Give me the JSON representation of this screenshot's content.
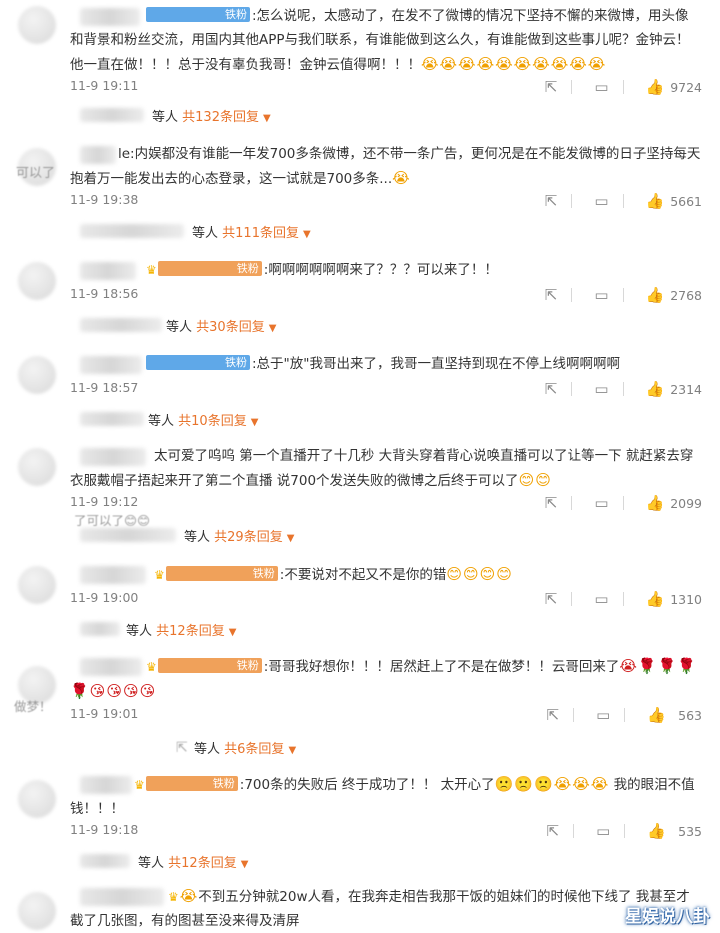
{
  "comments": [
    {
      "badge": "铁粉",
      "text": ":怎么说呢，太感动了，在发不了微博的情况下坚持不懈的来微博，用头像和背景和粉丝交流，用国内其他APP与我们联系，有谁能做到这么久，有谁能做到这些事儿呢？金钟云！他一直在做！！！总于没有辜负我哥！金钟云值得啊！！！",
      "emoji": "😭😭😭😭😭😭😭😭😭😭",
      "time": "11-9 19:11",
      "likes": "9724",
      "replies_prefix": "等人",
      "replies_count": "共132条回复"
    },
    {
      "badge": "",
      "text": "le:内娱都没有谁能一年发700多条微博，还不带一条广告，更何况是在不能发微博的日子坚持每天抱着万一能发出去的心态登录，这一试就是700多条...",
      "emoji": "😭",
      "time": "11-9 19:38",
      "likes": "5661",
      "replies_prefix": "等人",
      "replies_count": "共111条回复"
    },
    {
      "badge": "铁粉",
      "text": ":啊啊啊啊啊啊来了？？？可以来了！！",
      "emoji": "",
      "time": "11-9 18:56",
      "likes": "2768",
      "replies_prefix": "等人",
      "replies_count": "共30条回复"
    },
    {
      "badge": "铁粉",
      "text": ":总于\"放\"我哥出来了，我哥一直坚持到现在不停上线啊啊啊啊",
      "emoji": "",
      "time": "11-9 18:57",
      "likes": "2314",
      "replies_prefix": "等人",
      "replies_count": "共10条回复"
    },
    {
      "badge": "",
      "text": "太可爱了呜呜 第一个直播开了十几秒 大背头穿着背心说唤直播可以了让等一下 就赶紧去穿衣服戴帽子捂起来开了第二个直播 说700个发送失败的微博之后终于可以了",
      "emoji": "😊😊",
      "time": "11-9 19:12",
      "likes": "2099",
      "replies_prefix": "等人",
      "replies_count": "共29条回复"
    },
    {
      "badge": "铁粉",
      "text": ":不要说对不起又不是你的错",
      "emoji": "😊😊😊😊",
      "time": "11-9 19:00",
      "likes": "1310",
      "replies_prefix": "等人",
      "replies_count": "共12条回复"
    },
    {
      "badge": "铁粉",
      "text": ":哥哥我好想你！！！居然赶上了不是在做梦！！云哥回来了",
      "emoji": "😭🌹🌹🌹🌹😘😘😘😘",
      "time": "11-9 19:01",
      "likes": "563",
      "replies_prefix": "等人",
      "replies_count": "共6条回复"
    },
    {
      "badge": "铁粉",
      "text": ":700条的失败后 终于成功了！！ 太开心了",
      "emoji": "🙁🙁🙁😭😭😭",
      "text2": "我的眼泪不值钱！！！",
      "time": "11-9 19:18",
      "likes": "535",
      "replies_prefix": "等人",
      "replies_count": "共12条回复"
    },
    {
      "badge": "",
      "text": "不到五分钟就20w人看，在我奔走相告我那干饭的姐妹们的时候他下线了 我甚至才截了几张图，有的图甚至没来得及清屏",
      "emoji": "😭",
      "time": "",
      "likes": "",
      "replies_prefix": "",
      "replies_count": ""
    }
  ],
  "fragments": {
    "f1": "可以了",
    "f2": "了可以了😊😊",
    "f3": "做梦！"
  },
  "watermark": "星娱说八卦",
  "colors": {
    "accent": "#e8742c",
    "badge": "#5fa8e8"
  }
}
